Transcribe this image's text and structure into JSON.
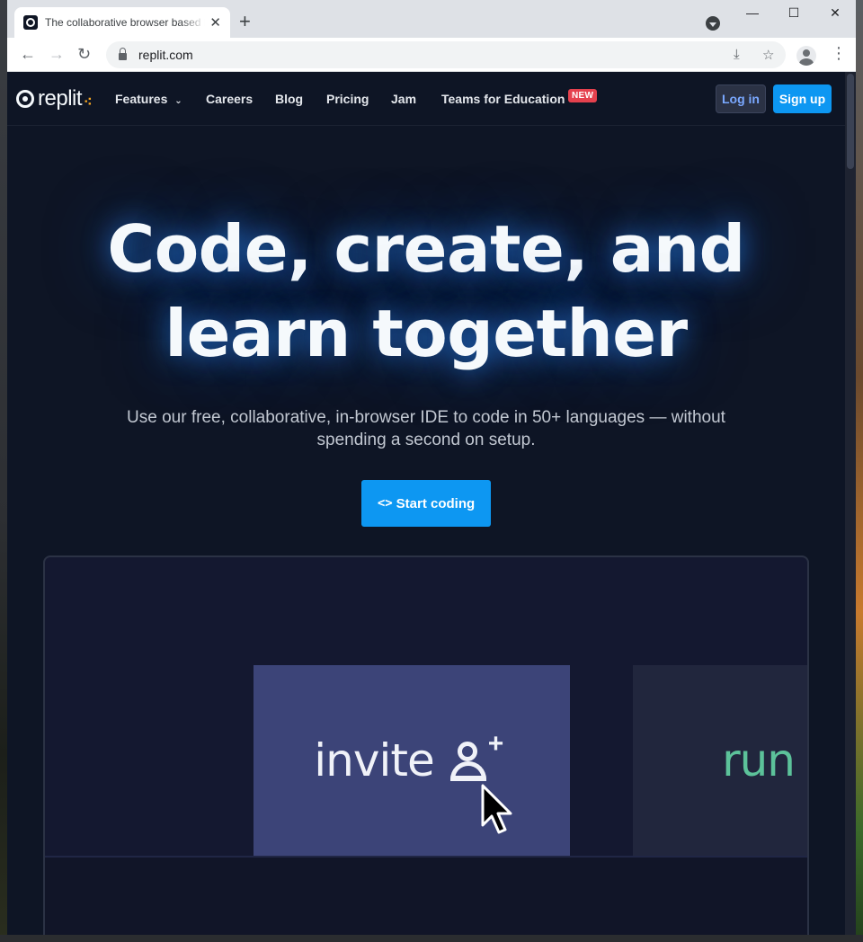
{
  "browser": {
    "tab_title": "The collaborative browser based IDE",
    "tab_close": "✕",
    "new_tab": "+",
    "url": "replit.com",
    "window_controls": {
      "minimize": "—",
      "maximize": "☐",
      "close": "✕"
    }
  },
  "site": {
    "logo_text": "replit",
    "nav": [
      {
        "label": "Features",
        "has_dropdown": true
      },
      {
        "label": "Careers"
      },
      {
        "label": "Blog"
      },
      {
        "label": "Pricing"
      },
      {
        "label": "Jam"
      },
      {
        "label": "Teams for Education",
        "badge": "NEW"
      }
    ],
    "login_label": "Log in",
    "signup_label": "Sign up",
    "hero": {
      "title_line1": "Code, create, and",
      "title_line2": "learn together",
      "subtitle": "Use our free, collaborative, in-browser IDE to code in 50+ languages — without spending a second on setup.",
      "cta_icon": "<>",
      "cta_label": "Start coding"
    },
    "demo": {
      "invite_label": "invite",
      "run_label": "run"
    }
  },
  "colors": {
    "page_bg": "#0e1525",
    "accent": "#0d97f2",
    "badge": "#e5414e",
    "invite_card": "#3c4478",
    "run_text": "#5cc29a"
  }
}
